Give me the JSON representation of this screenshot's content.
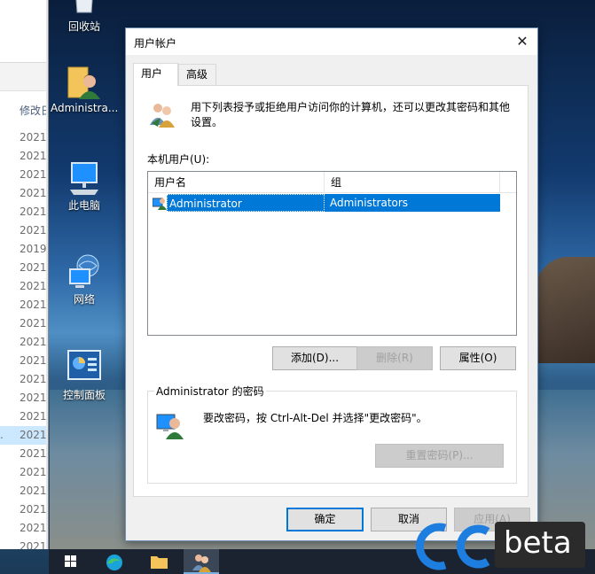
{
  "explorer": {
    "column_header": "修改日",
    "dates": [
      "2021/",
      "2021/",
      "2021/",
      "2021/",
      "2021/",
      "2021/",
      "2019/",
      "2021/",
      "2021/",
      "2021/",
      "2021/",
      "2021/",
      "2021/",
      "2021/",
      "2021/",
      "2021/",
      "2021/",
      "2021/",
      "2021/",
      "2021/",
      "2021/",
      "2021/",
      "2021/",
      "2021/"
    ],
    "selected_prefix": "."
  },
  "desktop": {
    "icons": [
      {
        "label": "回收站"
      },
      {
        "label": "Administra..."
      },
      {
        "label": "此电脑"
      },
      {
        "label": "网络"
      },
      {
        "label": "控制面板"
      }
    ]
  },
  "dialog": {
    "title": "用户帐户",
    "close_glyph": "✕",
    "tabs": [
      {
        "label": "用户"
      },
      {
        "label": "高级"
      }
    ],
    "intro": "用下列表授予或拒绝用户访问你的计算机，还可以更改其密码和其他设置。",
    "list_label": "本机用户(U):",
    "columns": [
      "用户名",
      "组"
    ],
    "rows": [
      {
        "user": "Administrator",
        "group": "Administrators"
      }
    ],
    "buttons": {
      "add": "添加(D)...",
      "remove": "删除(R)",
      "properties": "属性(O)",
      "reset_password": "重置密码(P)...",
      "ok": "确定",
      "cancel": "取消",
      "apply": "应用(A)"
    },
    "password_group_title": "Administrator 的密码",
    "password_hint": "要改密码，按 Ctrl-Alt-Del 并选择\"更改密码\"。"
  },
  "watermark": {
    "text": "beta"
  },
  "colors": {
    "accent": "#0078d7",
    "selection": "#0078d7"
  }
}
